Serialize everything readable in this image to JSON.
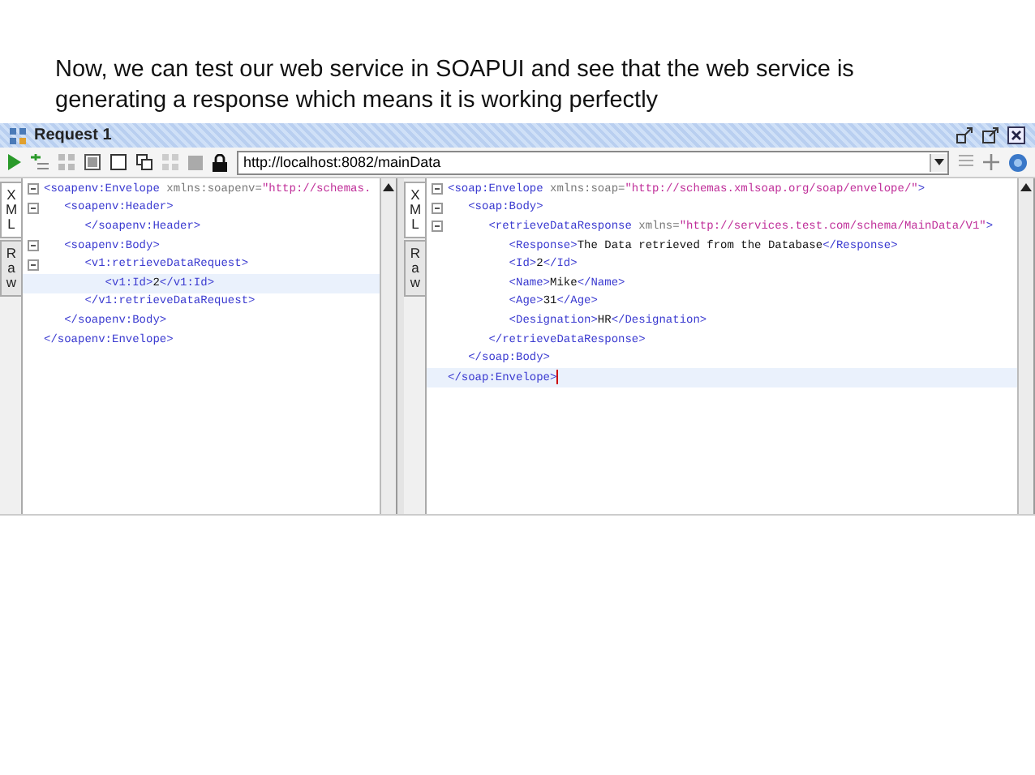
{
  "caption": "Now, we can test our web service in SOAPUI  and see that the web service is generating a response which means it is working perfectly",
  "window": {
    "title": "Request 1"
  },
  "toolbar": {
    "url": "http://localhost:8082/mainData"
  },
  "panes": [
    {
      "tabs": [
        {
          "label": "XML",
          "selected": true
        },
        {
          "label": "Raw",
          "selected": false
        }
      ],
      "lines": [
        {
          "fold": true,
          "highlighted": false,
          "tokens": [
            {
              "kind": "tag",
              "text": "<soapenv:Envelope"
            },
            {
              "kind": "attr",
              "text": " xmlns:soapenv="
            },
            {
              "kind": "value",
              "text": "\"http://schemas."
            }
          ]
        },
        {
          "fold": true,
          "highlighted": false,
          "tokens": [
            {
              "kind": "tag",
              "text": "   <soapenv:Header>"
            }
          ]
        },
        {
          "fold": false,
          "highlighted": false,
          "tokens": [
            {
              "kind": "tag",
              "text": "      </soapenv:Header>"
            }
          ]
        },
        {
          "fold": true,
          "highlighted": false,
          "tokens": [
            {
              "kind": "tag",
              "text": "   <soapenv:Body>"
            }
          ]
        },
        {
          "fold": true,
          "highlighted": false,
          "tokens": [
            {
              "kind": "tag",
              "text": "      <v1:retrieveDataRequest>"
            }
          ]
        },
        {
          "fold": false,
          "highlighted": true,
          "tokens": [
            {
              "kind": "tag",
              "text": "         <v1:Id>"
            },
            {
              "kind": "text",
              "text": "2"
            },
            {
              "kind": "tag",
              "text": "</v1:Id>"
            }
          ]
        },
        {
          "fold": false,
          "highlighted": false,
          "tokens": [
            {
              "kind": "tag",
              "text": "      </v1:retrieveDataRequest>"
            }
          ]
        },
        {
          "fold": false,
          "highlighted": false,
          "tokens": [
            {
              "kind": "tag",
              "text": "   </soapenv:Body>"
            }
          ]
        },
        {
          "fold": false,
          "highlighted": false,
          "tokens": [
            {
              "kind": "tag",
              "text": "</soapenv:Envelope>"
            }
          ]
        }
      ]
    },
    {
      "tabs": [
        {
          "label": "XML",
          "selected": true
        },
        {
          "label": "Raw",
          "selected": false
        }
      ],
      "lines": [
        {
          "fold": true,
          "highlighted": false,
          "tokens": [
            {
              "kind": "tag",
              "text": "<soap:Envelope"
            },
            {
              "kind": "attr",
              "text": " xmlns:soap="
            },
            {
              "kind": "value",
              "text": "\"http://schemas.xmlsoap.org/soap/envelope/\""
            },
            {
              "kind": "tag",
              "text": ">"
            }
          ]
        },
        {
          "fold": true,
          "highlighted": false,
          "tokens": [
            {
              "kind": "tag",
              "text": "   <soap:Body>"
            }
          ]
        },
        {
          "fold": true,
          "highlighted": false,
          "tokens": [
            {
              "kind": "tag",
              "text": "      <retrieveDataResponse"
            },
            {
              "kind": "attr",
              "text": " xmlns="
            },
            {
              "kind": "value",
              "text": "\"http://services.test.com/schema/MainData/V1\""
            },
            {
              "kind": "tag",
              "text": ">"
            }
          ]
        },
        {
          "fold": false,
          "highlighted": false,
          "tokens": [
            {
              "kind": "tag",
              "text": "         <Response>"
            },
            {
              "kind": "text",
              "text": "The Data retrieved from the Database"
            },
            {
              "kind": "tag",
              "text": "</Response>"
            }
          ]
        },
        {
          "fold": false,
          "highlighted": false,
          "tokens": [
            {
              "kind": "tag",
              "text": "         <Id>"
            },
            {
              "kind": "text",
              "text": "2"
            },
            {
              "kind": "tag",
              "text": "</Id>"
            }
          ]
        },
        {
          "fold": false,
          "highlighted": false,
          "tokens": [
            {
              "kind": "tag",
              "text": "         <Name>"
            },
            {
              "kind": "text",
              "text": "Mike"
            },
            {
              "kind": "tag",
              "text": "</Name>"
            }
          ]
        },
        {
          "fold": false,
          "highlighted": false,
          "tokens": [
            {
              "kind": "tag",
              "text": "         <Age>"
            },
            {
              "kind": "text",
              "text": "31"
            },
            {
              "kind": "tag",
              "text": "</Age>"
            }
          ]
        },
        {
          "fold": false,
          "highlighted": false,
          "tokens": [
            {
              "kind": "tag",
              "text": "         <Designation>"
            },
            {
              "kind": "text",
              "text": "HR"
            },
            {
              "kind": "tag",
              "text": "</Designation>"
            }
          ]
        },
        {
          "fold": false,
          "highlighted": false,
          "tokens": [
            {
              "kind": "tag",
              "text": "      </retrieveDataResponse>"
            }
          ]
        },
        {
          "fold": false,
          "highlighted": false,
          "tokens": [
            {
              "kind": "tag",
              "text": "   </soap:Body>"
            }
          ]
        },
        {
          "fold": false,
          "highlighted": true,
          "tokens": [
            {
              "kind": "tag",
              "text": "</soap:Envelope>"
            }
          ]
        }
      ]
    }
  ]
}
